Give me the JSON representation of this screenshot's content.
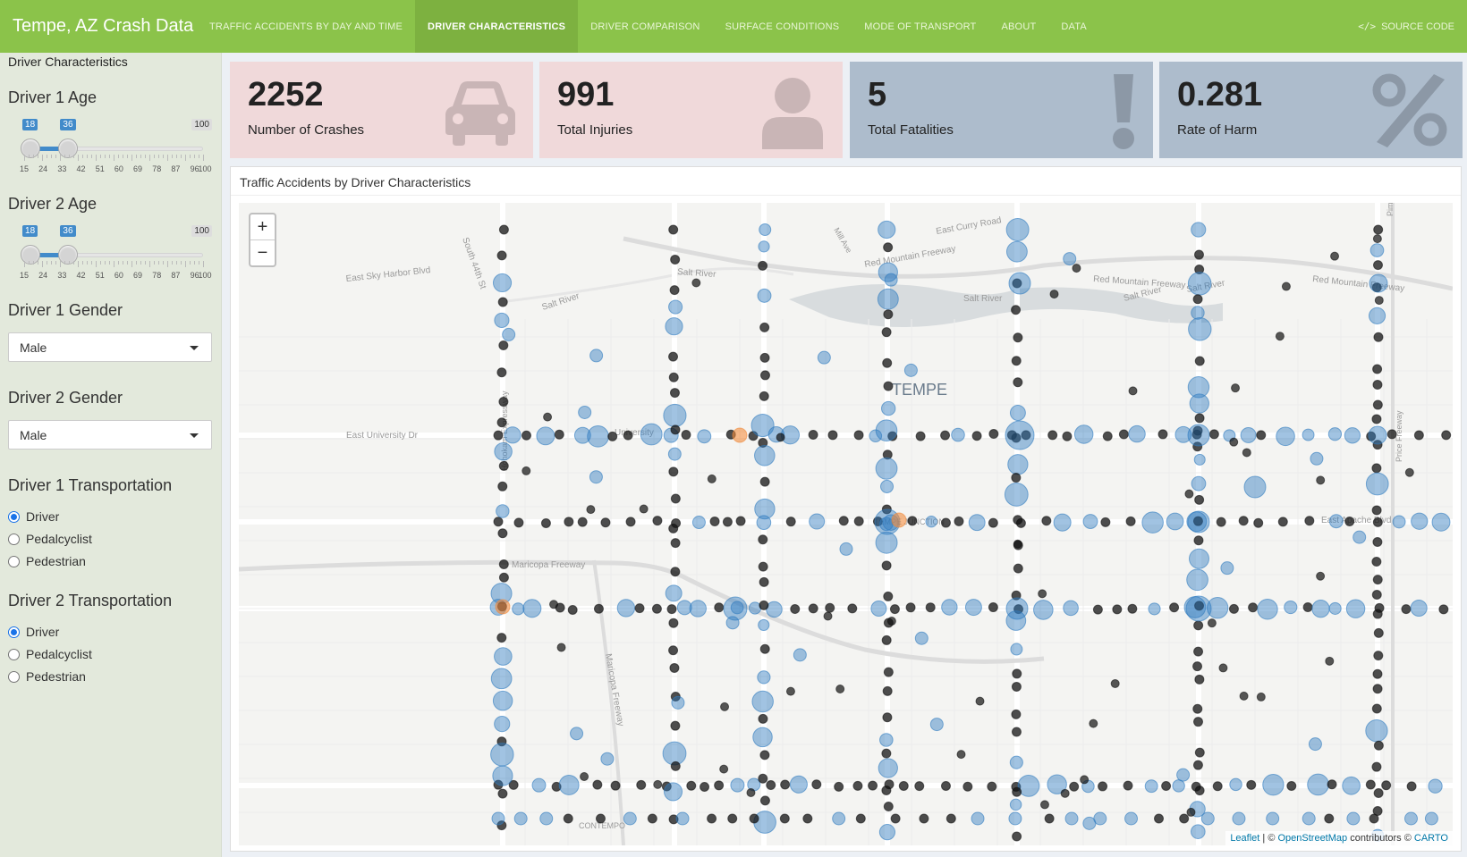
{
  "header": {
    "title": "Tempe, AZ Crash Data",
    "tabs": [
      {
        "label": "TRAFFIC ACCIDENTS BY DAY AND TIME",
        "active": false
      },
      {
        "label": "DRIVER CHARACTERISTICS",
        "active": true
      },
      {
        "label": "DRIVER COMPARISON",
        "active": false
      },
      {
        "label": "SURFACE CONDITIONS",
        "active": false
      },
      {
        "label": "MODE OF TRANSPORT",
        "active": false
      },
      {
        "label": "ABOUT",
        "active": false
      },
      {
        "label": "DATA",
        "active": false
      }
    ],
    "source_code": "SOURCE CODE"
  },
  "sidebar": {
    "title": "Driver Characteristics",
    "driver1_age": {
      "label": "Driver 1 Age",
      "from": "18",
      "to": "36",
      "max": "100",
      "min_value": 15,
      "max_value": 100,
      "selected_from": 18,
      "selected_to": 36
    },
    "driver2_age": {
      "label": "Driver 2 Age",
      "from": "18",
      "to": "36",
      "max": "100",
      "min_value": 15,
      "max_value": 100,
      "selected_from": 18,
      "selected_to": 36
    },
    "age_ticks": [
      "15",
      "24",
      "33",
      "42",
      "51",
      "60",
      "69",
      "78",
      "87",
      "96",
      "100"
    ],
    "driver1_gender": {
      "label": "Driver 1 Gender",
      "value": "Male"
    },
    "driver2_gender": {
      "label": "Driver 2 Gender",
      "value": "Male"
    },
    "driver1_transport": {
      "label": "Driver 1 Transportation",
      "options": [
        "Driver",
        "Pedalcyclist",
        "Pedestrian"
      ],
      "selected": "Driver"
    },
    "driver2_transport": {
      "label": "Driver 2 Transportation",
      "options": [
        "Driver",
        "Pedalcyclist",
        "Pedestrian"
      ],
      "selected": "Driver"
    }
  },
  "stats": {
    "crashes": {
      "value": "2252",
      "label": "Number of Crashes",
      "icon": "car-icon"
    },
    "injuries": {
      "value": "991",
      "label": "Total Injuries",
      "icon": "user-icon"
    },
    "fatalities": {
      "value": "5",
      "label": "Total Fatalities",
      "icon": "exclamation-icon"
    },
    "harm": {
      "value": "0.281",
      "label": "Rate of Harm",
      "icon": "percent-icon"
    }
  },
  "map": {
    "title": "Traffic Accidents by Driver Characteristics",
    "zoom_in": "+",
    "zoom_out": "−",
    "labels": [
      "Red Mountain Freeway",
      "Red Mountain Freeway",
      "Red Mountain Freeway",
      "Salt River",
      "Salt River",
      "Salt River",
      "Salt River",
      "Salt River",
      "East Sky Harbor Blvd",
      "East University Dr",
      "University",
      "East Curry Road",
      "Maricopa Freeway",
      "Maricopa Freeway",
      "TEMPE",
      "TEMPE JUNCTION",
      "East Apache Blvd",
      "CONTEMPO",
      "South 44th St",
      "Hohokam Expressway",
      "Pima",
      "Price Freeway",
      "Mill Ave"
    ],
    "attribution": {
      "leaflet": "Leaflet",
      "sep": " | © ",
      "osm": "OpenStreetMap",
      "mid": " contributors © ",
      "carto": "CARTO"
    },
    "colors": {
      "driver_dot": "#111111",
      "injury_dot": "#2f7bbf",
      "fatal_dot": "#f08a3c"
    }
  }
}
